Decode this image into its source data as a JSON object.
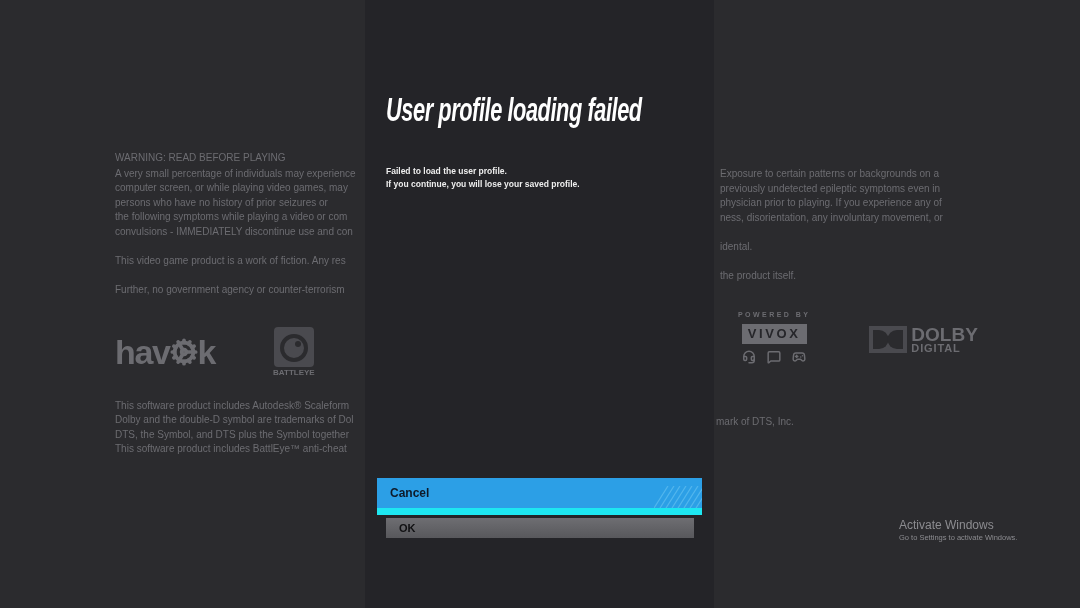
{
  "background": {
    "left_text": {
      "heading": "WARNING: READ BEFORE PLAYING",
      "warning_lines": [
        "A very small percentage of individuals may experience",
        "computer screen, or while playing video games, may",
        "persons who have no history of prior seizures or",
        "the following symptoms while playing a video or com",
        "convulsions - IMMEDIATELY discontinue use and con"
      ],
      "fiction_line": "This video game product is a work of fiction. Any res",
      "government_line": "Further, no government agency or counter-terrorism",
      "legal_lines": [
        "This software product includes Autodesk® Scaleform",
        "Dolby and the double-D symbol are trademarks of Dol",
        "DTS, the Symbol, and DTS plus the Symbol together",
        "This software product includes BattlEye™ anti-cheat"
      ]
    },
    "logos": {
      "havok": {
        "text_before": "hav",
        "text_after": "k"
      },
      "battleye": {
        "caption": "BATTLEYE"
      },
      "vivox": {
        "caption": "POWERED BY",
        "wordmark": "VIVOX"
      },
      "dolby": {
        "line_1": "DOLBY",
        "line_2": "DIGITAL"
      }
    },
    "right_text": {
      "warning_lines": [
        "Exposure to certain patterns or backgrounds on a",
        "previously undetected epileptic symptoms even in",
        "physician prior to playing. If you experience any of",
        "ness, disorientation, any involuntary movement, or"
      ],
      "fiction_line": "idental.",
      "government_line": "the product itself.",
      "legal_line": "mark of DTS, Inc."
    }
  },
  "dialog": {
    "title": "User profile loading failed",
    "message_lines": [
      "Failed to load the user profile.",
      "If you continue, you will lose your saved profile."
    ],
    "buttons": [
      {
        "label": "Cancel",
        "selected": true
      },
      {
        "label": "OK",
        "selected": false
      }
    ]
  },
  "activation_notice": {
    "title": "Activate Windows",
    "subtitle": "Go to Settings to activate Windows."
  }
}
